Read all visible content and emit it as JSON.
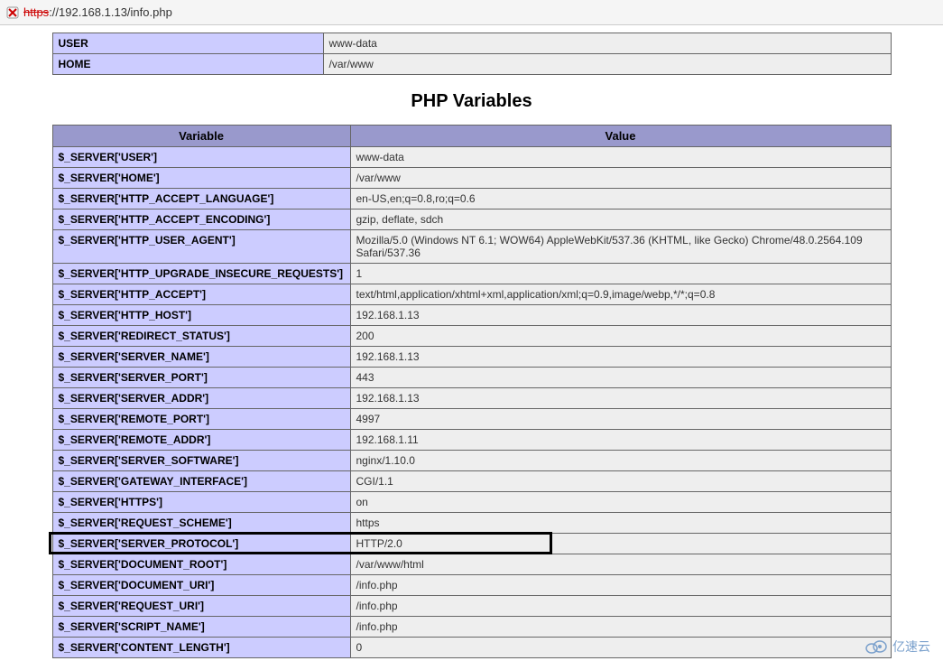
{
  "address_bar": {
    "scheme_strike": "https",
    "rest": "://192.168.1.13/info.php"
  },
  "env_table": {
    "rows": [
      {
        "name": "USER",
        "value": "www-data"
      },
      {
        "name": "HOME",
        "value": "/var/www"
      }
    ]
  },
  "section_title": "PHP Variables",
  "vars_table": {
    "head_var": "Variable",
    "head_val": "Value",
    "rows": [
      {
        "name": "$_SERVER['USER']",
        "value": "www-data",
        "hl": false
      },
      {
        "name": "$_SERVER['HOME']",
        "value": "/var/www",
        "hl": false
      },
      {
        "name": "$_SERVER['HTTP_ACCEPT_LANGUAGE']",
        "value": "en-US,en;q=0.8,ro;q=0.6",
        "hl": false
      },
      {
        "name": "$_SERVER['HTTP_ACCEPT_ENCODING']",
        "value": "gzip, deflate, sdch",
        "hl": false
      },
      {
        "name": "$_SERVER['HTTP_USER_AGENT']",
        "value": "Mozilla/5.0 (Windows NT 6.1; WOW64) AppleWebKit/537.36 (KHTML, like Gecko) Chrome/48.0.2564.109 Safari/537.36",
        "hl": false
      },
      {
        "name": "$_SERVER['HTTP_UPGRADE_INSECURE_REQUESTS']",
        "value": "1",
        "hl": false
      },
      {
        "name": "$_SERVER['HTTP_ACCEPT']",
        "value": "text/html,application/xhtml+xml,application/xml;q=0.9,image/webp,*/*;q=0.8",
        "hl": false
      },
      {
        "name": "$_SERVER['HTTP_HOST']",
        "value": "192.168.1.13",
        "hl": false
      },
      {
        "name": "$_SERVER['REDIRECT_STATUS']",
        "value": "200",
        "hl": false
      },
      {
        "name": "$_SERVER['SERVER_NAME']",
        "value": "192.168.1.13",
        "hl": false
      },
      {
        "name": "$_SERVER['SERVER_PORT']",
        "value": "443",
        "hl": false
      },
      {
        "name": "$_SERVER['SERVER_ADDR']",
        "value": "192.168.1.13",
        "hl": false
      },
      {
        "name": "$_SERVER['REMOTE_PORT']",
        "value": "4997",
        "hl": false
      },
      {
        "name": "$_SERVER['REMOTE_ADDR']",
        "value": "192.168.1.11",
        "hl": false
      },
      {
        "name": "$_SERVER['SERVER_SOFTWARE']",
        "value": "nginx/1.10.0",
        "hl": false
      },
      {
        "name": "$_SERVER['GATEWAY_INTERFACE']",
        "value": "CGI/1.1",
        "hl": false
      },
      {
        "name": "$_SERVER['HTTPS']",
        "value": "on",
        "hl": false
      },
      {
        "name": "$_SERVER['REQUEST_SCHEME']",
        "value": "https",
        "hl": false
      },
      {
        "name": "$_SERVER['SERVER_PROTOCOL']",
        "value": "HTTP/2.0",
        "hl": true
      },
      {
        "name": "$_SERVER['DOCUMENT_ROOT']",
        "value": "/var/www/html",
        "hl": false
      },
      {
        "name": "$_SERVER['DOCUMENT_URI']",
        "value": "/info.php",
        "hl": false
      },
      {
        "name": "$_SERVER['REQUEST_URI']",
        "value": "/info.php",
        "hl": false
      },
      {
        "name": "$_SERVER['SCRIPT_NAME']",
        "value": "/info.php",
        "hl": false
      },
      {
        "name": "$_SERVER['CONTENT_LENGTH']",
        "value": "0",
        "hl": false
      }
    ]
  },
  "watermark_text": "亿速云"
}
